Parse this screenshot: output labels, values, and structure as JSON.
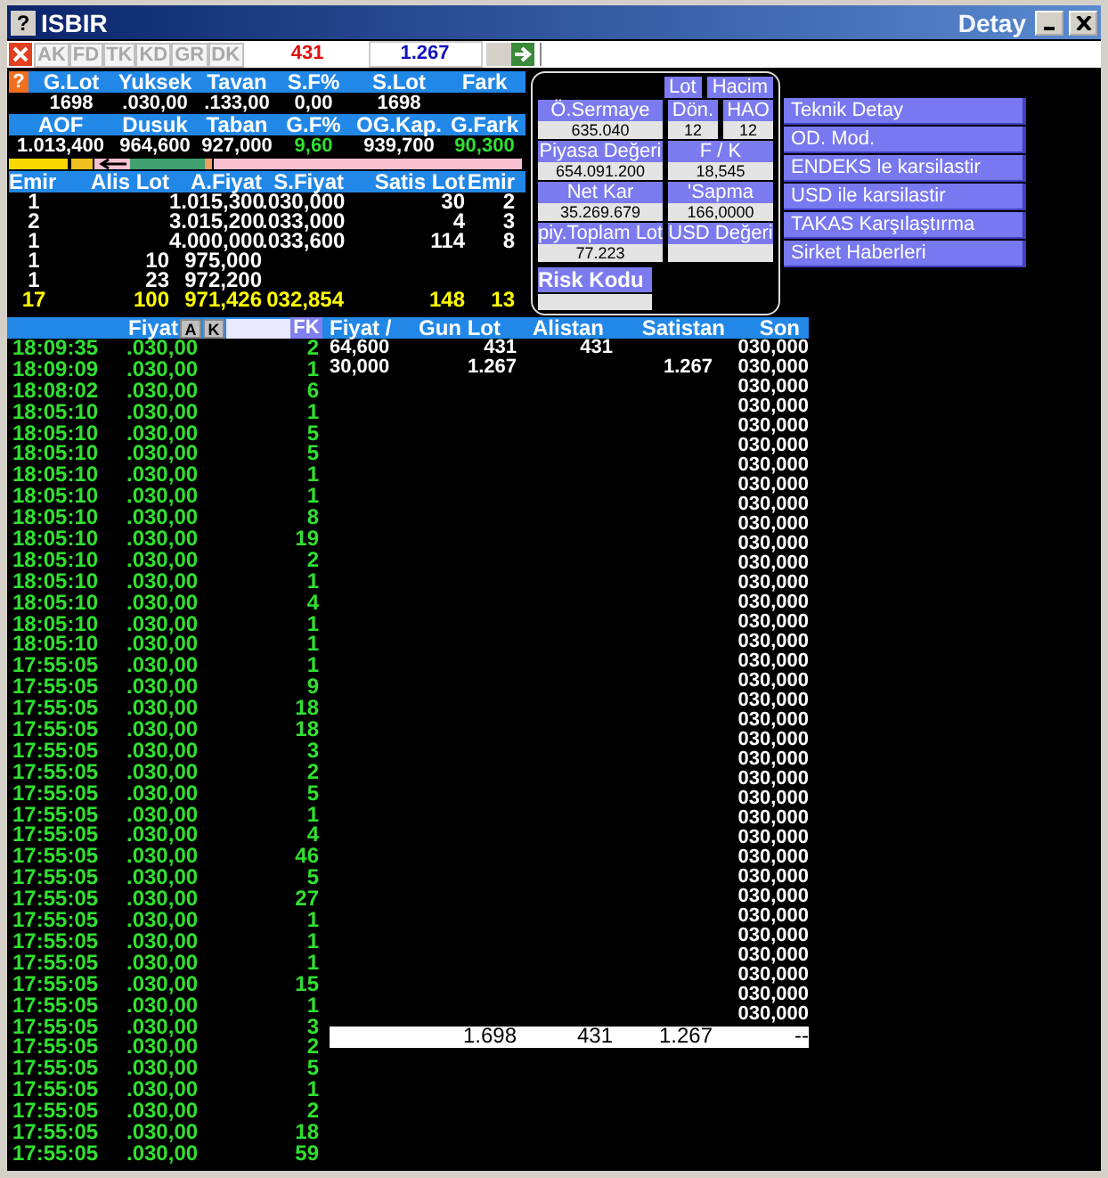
{
  "window": {
    "help": "?",
    "title": "ISBIR",
    "subtitle": "Detay"
  },
  "toolbar": {
    "tabs": [
      {
        "label": "AK",
        "disabled": true
      },
      {
        "label": "FD",
        "disabled": true
      },
      {
        "label": "TK",
        "disabled": true
      },
      {
        "label": "KD",
        "disabled": true
      },
      {
        "label": "GR",
        "disabled": true
      },
      {
        "label": "DK",
        "disabled": true
      }
    ],
    "buy_count": "431",
    "sell_count": "1.267"
  },
  "summary": {
    "help": "?",
    "header1": [
      "G.Lot",
      "Yuksek",
      "Tavan",
      "S.F%",
      "S.Lot",
      "Fark"
    ],
    "row1": [
      {
        "text": "1698",
        "up": false
      },
      {
        "text": ".030,00",
        "up": false
      },
      {
        "text": ".133,00",
        "up": false
      },
      {
        "text": "0,00",
        "up": false
      },
      {
        "text": "1698",
        "up": false
      }
    ],
    "header2": [
      "AOF",
      "Dusuk",
      "Taban",
      "G.F%",
      "OG.Kap.",
      "G.Fark"
    ],
    "row2": [
      {
        "text": "1.013,400",
        "up": false
      },
      {
        "text": "964,600",
        "up": false
      },
      {
        "text": "927,000",
        "up": false
      },
      {
        "text": "9,60",
        "up": true
      },
      {
        "text": "939,700",
        "up": false
      },
      {
        "text": "90,300",
        "up": true
      }
    ]
  },
  "order_book": {
    "columns": [
      "Emir",
      "Alis Lot",
      "A.Fiyat",
      "S.Fiyat",
      "Satis Lot",
      "Emir"
    ],
    "rows": [
      {
        "buy_orders": "1",
        "buy_price": "1.015,300",
        "sell_price": ".030,000",
        "sell_lot": "30",
        "sell_orders": "2"
      },
      {
        "buy_orders": "2",
        "buy_price": "3.015,200",
        "sell_price": ".033,000",
        "sell_lot": "4",
        "sell_orders": "3"
      },
      {
        "buy_orders": "1",
        "buy_price": "4.000,000",
        "sell_price": ".033,600",
        "sell_lot": "114",
        "sell_orders": "8"
      },
      {
        "buy_orders": "1",
        "buy_lot": "10",
        "buy_price": "975,000"
      },
      {
        "buy_orders": "1",
        "buy_lot": "23",
        "buy_price": "972,200"
      }
    ],
    "total": {
      "buy_orders": "17",
      "buy_lot": "100",
      "buy_price": "971,426",
      "sell_price": "032,854",
      "sell_lot": "148",
      "sell_orders": "13"
    }
  },
  "detail": {
    "buttons": [
      "Lot",
      "Hacim"
    ],
    "rows": [
      [
        {
          "label": "Ö.Sermaye",
          "value": "635.040"
        },
        {
          "label": "Dön.",
          "value": "12"
        },
        {
          "label": "HAO",
          "value": "12"
        }
      ],
      [
        {
          "label": "Piyasa Değeri",
          "value": "654.091.200"
        },
        {
          "label": "F / K",
          "value": "18,545"
        }
      ],
      [
        {
          "label": "Net Kar",
          "value": "35.269.679"
        },
        {
          "label": "'Sapma",
          "value": "166,0000"
        }
      ],
      [
        {
          "label": "piy.Toplam Lot",
          "value": "77.223"
        },
        {
          "label": "USD Değeri"
        }
      ]
    ],
    "risk_label": "Risk Kodu"
  },
  "menu": [
    "Teknik Detay",
    "OD. Mod.",
    "ENDEKS le karsilastir",
    "USD ile karsilastir",
    "TAKAS Karşılaştırma",
    "Sirket Haberleri"
  ],
  "trades": {
    "header": {
      "price": "Fiyat",
      "a_button": "A",
      "k_button": "K",
      "fk_button": "FK",
      "fiyat": "Fiyat /",
      "gun_lot": "Gun Lot",
      "alistan": "Alistan",
      "satistan": "Satistan",
      "son": "Son"
    },
    "rows": [
      {
        "time": "18:09:35",
        "price": ".030,00",
        "lot": "2"
      },
      {
        "time": "18:09:09",
        "price": ".030,00",
        "lot": "1"
      },
      {
        "time": "18:08:02",
        "price": ".030,00",
        "lot": "6"
      },
      {
        "time": "18:05:10",
        "price": ".030,00",
        "lot": "1"
      },
      {
        "time": "18:05:10",
        "price": ".030,00",
        "lot": "5"
      },
      {
        "time": "18:05:10",
        "price": ".030,00",
        "lot": "5"
      },
      {
        "time": "18:05:10",
        "price": ".030,00",
        "lot": "1"
      },
      {
        "time": "18:05:10",
        "price": ".030,00",
        "lot": "1"
      },
      {
        "time": "18:05:10",
        "price": ".030,00",
        "lot": "8"
      },
      {
        "time": "18:05:10",
        "price": ".030,00",
        "lot": "19"
      },
      {
        "time": "18:05:10",
        "price": ".030,00",
        "lot": "2"
      },
      {
        "time": "18:05:10",
        "price": ".030,00",
        "lot": "1"
      },
      {
        "time": "18:05:10",
        "price": ".030,00",
        "lot": "4"
      },
      {
        "time": "18:05:10",
        "price": ".030,00",
        "lot": "1"
      },
      {
        "time": "18:05:10",
        "price": ".030,00",
        "lot": "1"
      },
      {
        "time": "17:55:05",
        "price": ".030,00",
        "lot": "1"
      },
      {
        "time": "17:55:05",
        "price": ".030,00",
        "lot": "9"
      },
      {
        "time": "17:55:05",
        "price": ".030,00",
        "lot": "18"
      },
      {
        "time": "17:55:05",
        "price": ".030,00",
        "lot": "18"
      },
      {
        "time": "17:55:05",
        "price": ".030,00",
        "lot": "3"
      },
      {
        "time": "17:55:05",
        "price": ".030,00",
        "lot": "2"
      },
      {
        "time": "17:55:05",
        "price": ".030,00",
        "lot": "5"
      },
      {
        "time": "17:55:05",
        "price": ".030,00",
        "lot": "1"
      },
      {
        "time": "17:55:05",
        "price": ".030,00",
        "lot": "4"
      },
      {
        "time": "17:55:05",
        "price": ".030,00",
        "lot": "46"
      },
      {
        "time": "17:55:05",
        "price": ".030,00",
        "lot": "5"
      },
      {
        "time": "17:55:05",
        "price": ".030,00",
        "lot": "27"
      },
      {
        "time": "17:55:05",
        "price": ".030,00",
        "lot": "1"
      },
      {
        "time": "17:55:05",
        "price": ".030,00",
        "lot": "1"
      },
      {
        "time": "17:55:05",
        "price": ".030,00",
        "lot": "1"
      },
      {
        "time": "17:55:05",
        "price": ".030,00",
        "lot": "15"
      },
      {
        "time": "17:55:05",
        "price": ".030,00",
        "lot": "1"
      },
      {
        "time": "17:55:05",
        "price": ".030,00",
        "lot": "3"
      },
      {
        "time": "17:55:05",
        "price": ".030,00",
        "lot": "2"
      },
      {
        "time": "17:55:05",
        "price": ".030,00",
        "lot": "5"
      },
      {
        "time": "17:55:05",
        "price": ".030,00",
        "lot": "1"
      },
      {
        "time": "17:55:05",
        "price": ".030,00",
        "lot": "2"
      },
      {
        "time": "17:55:05",
        "price": ".030,00",
        "lot": "18"
      },
      {
        "time": "17:55:05",
        "price": ".030,00",
        "lot": "59"
      }
    ],
    "price_levels": [
      {
        "fiyat": "64,600",
        "gun_lot": "431",
        "alistan": "431",
        "son": "030,000"
      },
      {
        "fiyat": "30,000",
        "gun_lot": "1.267",
        "satistan": "1.267",
        "son": "030,000"
      },
      {
        "son": "030,000"
      },
      {
        "son": "030,000"
      },
      {
        "son": "030,000"
      },
      {
        "son": "030,000"
      },
      {
        "son": "030,000"
      },
      {
        "son": "030,000"
      },
      {
        "son": "030,000"
      },
      {
        "son": "030,000"
      },
      {
        "son": "030,000"
      },
      {
        "son": "030,000"
      },
      {
        "son": "030,000"
      },
      {
        "son": "030,000"
      },
      {
        "son": "030,000"
      },
      {
        "son": "030,000"
      },
      {
        "son": "030,000"
      },
      {
        "son": "030,000"
      },
      {
        "son": "030,000"
      },
      {
        "son": "030,000"
      },
      {
        "son": "030,000"
      },
      {
        "son": "030,000"
      },
      {
        "son": "030,000"
      },
      {
        "son": "030,000"
      },
      {
        "son": "030,000"
      },
      {
        "son": "030,000"
      },
      {
        "son": "030,000"
      },
      {
        "son": "030,000"
      },
      {
        "son": "030,000"
      },
      {
        "son": "030,000"
      },
      {
        "son": "030,000"
      },
      {
        "son": "030,000"
      },
      {
        "son": "030,000"
      },
      {
        "son": "030,000"
      },
      {
        "son": "030,000"
      }
    ],
    "total": {
      "gun_lot": "1.698",
      "alistan": "431",
      "satistan": "1.267",
      "son": "--"
    }
  }
}
